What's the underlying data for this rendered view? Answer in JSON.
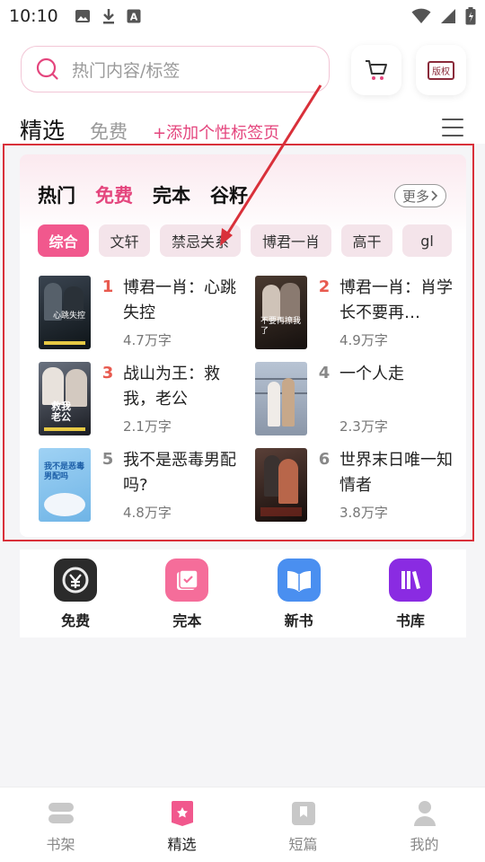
{
  "status_bar": {
    "time": "10:10",
    "icons": [
      "image-icon",
      "download-icon",
      "font-icon"
    ],
    "right_icons": [
      "wifi-icon",
      "signal-icon",
      "battery-icon"
    ]
  },
  "search": {
    "placeholder": "热门内容/标签"
  },
  "header_buttons": {
    "cart_icon": "cart-icon",
    "copyright_label": "版权"
  },
  "tabs": {
    "main": "精选",
    "free": "免费",
    "add": "+添加个性标签页"
  },
  "card": {
    "categories": [
      "热门",
      "免费",
      "完本",
      "谷籽"
    ],
    "active_category": "免费",
    "more": "更多",
    "chips": [
      "综合",
      "文轩",
      "禁忌关系",
      "博君一肖",
      "高干",
      "gl"
    ],
    "active_chip": "综合",
    "books": [
      {
        "rank": "1",
        "title": "博君一肖：心跳失控",
        "words": "4.7万字",
        "cover_text": "心跳失控"
      },
      {
        "rank": "2",
        "title": "博君一肖：肖学长不要再…",
        "words": "4.9万字",
        "cover_text": "不要再撩我了"
      },
      {
        "rank": "3",
        "title": "战山为王：救我，老公",
        "words": "2.1万字",
        "cover_text": "救我老公"
      },
      {
        "rank": "4",
        "title": "一个人走",
        "words": "2.3万字",
        "cover_text": ""
      },
      {
        "rank": "5",
        "title": "我不是恶毒男配吗?",
        "words": "4.8万字",
        "cover_text": "我不是恶毒男配吗"
      },
      {
        "rank": "6",
        "title": "世界末日唯一知情者",
        "words": "3.8万字",
        "cover_text": ""
      }
    ]
  },
  "shortcuts": [
    {
      "label": "免费",
      "icon": "free-coin-icon",
      "color": "#2b2b2b"
    },
    {
      "label": "完本",
      "icon": "complete-check-icon",
      "color": "#f56d9a"
    },
    {
      "label": "新书",
      "icon": "new-book-icon",
      "color": "#4a8ff0"
    },
    {
      "label": "书库",
      "icon": "library-icon",
      "color": "#8a2be2"
    }
  ],
  "bottom_nav": [
    {
      "label": "书架",
      "icon": "bookshelf-icon"
    },
    {
      "label": "精选",
      "icon": "featured-icon"
    },
    {
      "label": "短篇",
      "icon": "short-story-icon"
    },
    {
      "label": "我的",
      "icon": "profile-icon"
    }
  ],
  "colors": {
    "accent": "#e4457d",
    "rank_red": "#e85a4f",
    "annotation": "#d9303a"
  }
}
